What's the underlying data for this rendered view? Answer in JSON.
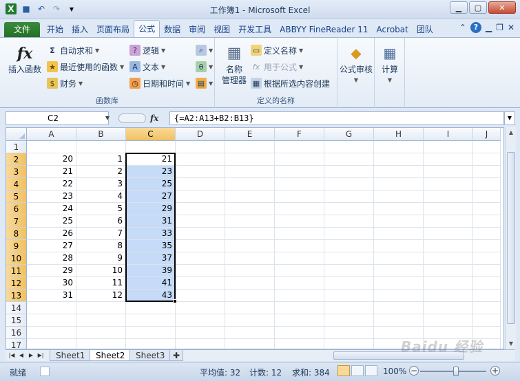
{
  "window": {
    "title": "工作簿1 - Microsoft Excel",
    "controls": {
      "minimize": "▁",
      "maximize": "▢",
      "close": "✕"
    }
  },
  "qat": {
    "icons": [
      "excel-logo-icon",
      "save-icon",
      "undo-icon",
      "redo-icon",
      "customize-icon"
    ]
  },
  "ribbon": {
    "tabs": [
      "文件",
      "开始",
      "插入",
      "页面布局",
      "公式",
      "数据",
      "审阅",
      "视图",
      "开发工具",
      "ABBYY FineReader 11",
      "Acrobat",
      "团队"
    ],
    "active_tab": "公式",
    "groups": {
      "function_library": {
        "label": "函数库",
        "insert_function": "插入函数",
        "insert_function_icon": "fx",
        "autosum": "自动求和",
        "recent": "最近使用的函数",
        "financial": "财务",
        "logical": "逻辑",
        "text": "文本",
        "datetime": "日期和时间"
      },
      "defined_names": {
        "label": "定义的名称",
        "name_manager_line1": "名称",
        "name_manager_line2": "管理器",
        "define_name": "定义名称",
        "use_in_formula": "用于公式",
        "create_from_selection": "根据所选内容创建"
      },
      "audit": {
        "label": "公式审核"
      },
      "calc": {
        "label": "计算"
      }
    }
  },
  "formula_bar": {
    "name_box": "C2",
    "fx": "fx",
    "formula": "{=A2:A13+B2:B13}"
  },
  "sheet": {
    "columns": [
      "A",
      "B",
      "C",
      "D",
      "E",
      "F",
      "G",
      "H",
      "I",
      "J"
    ],
    "selected_column": "C",
    "rows": [
      "1",
      "2",
      "3",
      "4",
      "5",
      "6",
      "7",
      "8",
      "9",
      "10",
      "11",
      "12",
      "13",
      "14",
      "15",
      "16",
      "17"
    ],
    "data": [
      [
        "",
        "",
        ""
      ],
      [
        "20",
        "1",
        "21"
      ],
      [
        "21",
        "2",
        "23"
      ],
      [
        "22",
        "3",
        "25"
      ],
      [
        "23",
        "4",
        "27"
      ],
      [
        "24",
        "5",
        "29"
      ],
      [
        "25",
        "6",
        "31"
      ],
      [
        "26",
        "7",
        "33"
      ],
      [
        "27",
        "8",
        "35"
      ],
      [
        "28",
        "9",
        "37"
      ],
      [
        "29",
        "10",
        "39"
      ],
      [
        "30",
        "11",
        "41"
      ],
      [
        "31",
        "12",
        "43"
      ]
    ]
  },
  "sheet_tabs": [
    "Sheet1",
    "Sheet2",
    "Sheet3"
  ],
  "active_sheet": "Sheet2",
  "status": {
    "ready": "就绪",
    "average": "平均值: 32",
    "count": "计数: 12",
    "sum": "求和: 384",
    "zoom": "100%"
  },
  "watermark": "Baidu 经验"
}
